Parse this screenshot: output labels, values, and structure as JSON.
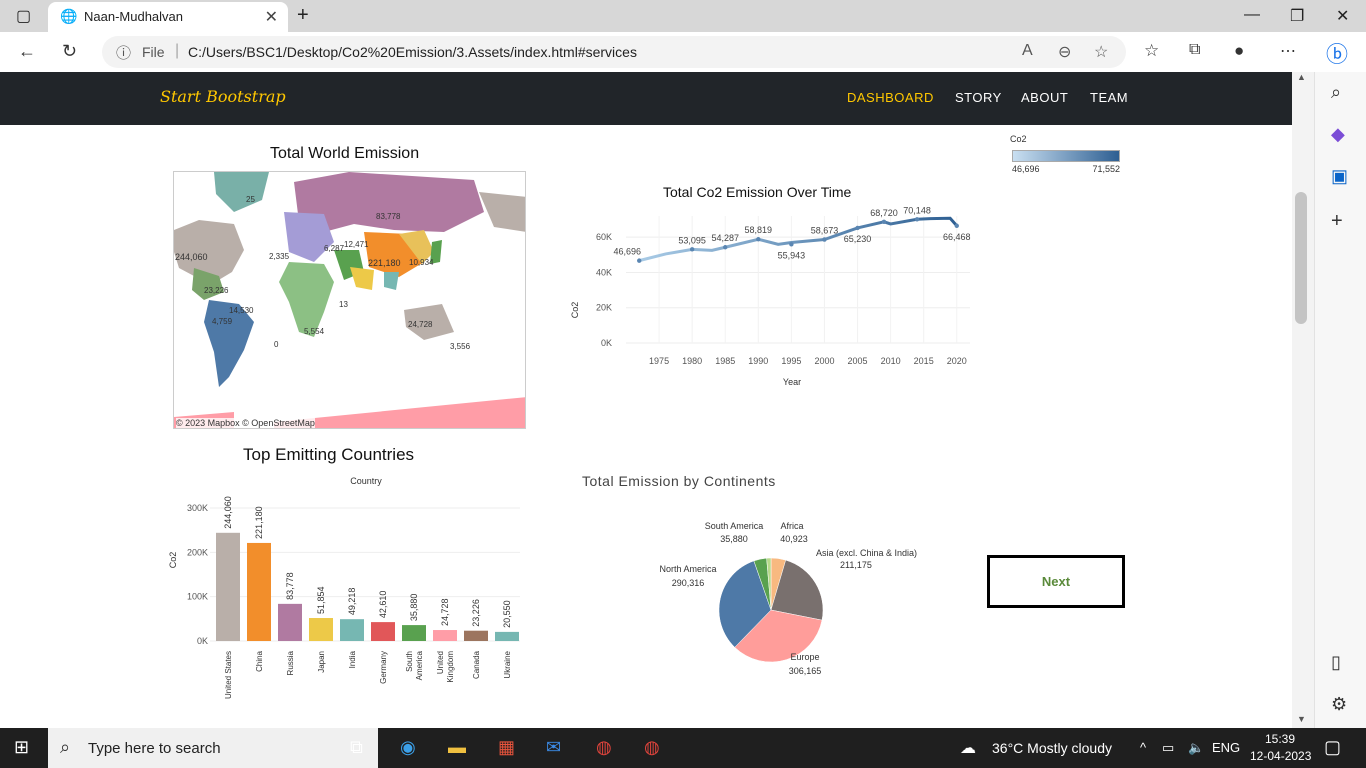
{
  "browser": {
    "tab_title": "Naan-Mudhalvan",
    "addr_label": "File",
    "url": "C:/Users/BSC1/Desktop/Co2%20Emission/3.Assets/index.html#services"
  },
  "site": {
    "brand": "Start Bootstrap",
    "nav": [
      "DASHBOARD",
      "STORY",
      "ABOUT",
      "TEAM"
    ]
  },
  "map": {
    "title": "Total World Emission",
    "credit": "© 2023 Mapbox © OpenStreetMap",
    "labels": [
      "25",
      "83,778",
      "244,060",
      "221,180",
      "24,728",
      "14,530",
      "12,471",
      "10,934",
      "2,335",
      "23,226",
      "4,759",
      "5,554",
      "6,287",
      "3,556",
      "13",
      "0"
    ]
  },
  "legend": {
    "title": "Co2",
    "min": "46,696",
    "max": "71,552"
  },
  "line_title": "Total Co2 Emission Over Time",
  "pie_title": "Total Emission  by Continents",
  "bar_title": "Top Emitting Countries",
  "chart_data": [
    {
      "type": "line",
      "title": "Total Co2 Emission Over Time",
      "xlabel": "Year",
      "ylabel": "Co2",
      "x": [
        1972,
        1976,
        1980,
        1983,
        1985,
        1990,
        1993,
        1995,
        2000,
        2005,
        2009,
        2010,
        2014,
        2016,
        2019,
        2020
      ],
      "y": [
        46696,
        50500,
        53095,
        52500,
        54287,
        58819,
        55943,
        57000,
        58673,
        65230,
        68720,
        67500,
        70148,
        70500,
        70700,
        66468
      ],
      "xticks": [
        "1975",
        "1980",
        "1985",
        "1990",
        "1995",
        "2000",
        "2005",
        "2010",
        "2015",
        "2020"
      ],
      "yticks": [
        "0K",
        "20K",
        "40K",
        "60K"
      ],
      "ylim": [
        0,
        72000
      ],
      "point_labels": [
        {
          "x": 1972,
          "y": 46696,
          "text": "46,696"
        },
        {
          "x": 1980,
          "y": 53095,
          "text": "53,095"
        },
        {
          "x": 1985,
          "y": 54287,
          "text": "54,287"
        },
        {
          "x": 1990,
          "y": 58819,
          "text": "58,819"
        },
        {
          "x": 1995,
          "y": 55943,
          "text": "55,943"
        },
        {
          "x": 2000,
          "y": 58673,
          "text": "58,673"
        },
        {
          "x": 2005,
          "y": 65230,
          "text": "65,230"
        },
        {
          "x": 2009,
          "y": 68720,
          "text": "68,720"
        },
        {
          "x": 2014,
          "y": 70148,
          "text": "70,148"
        },
        {
          "x": 2020,
          "y": 66468,
          "text": "66,468"
        }
      ]
    },
    {
      "type": "bar",
      "title": "Top Emitting Countries",
      "xlabel": "Country",
      "ylabel": "Co2",
      "categories": [
        "United States",
        "China",
        "Russia",
        "Japan",
        "India",
        "Germany",
        "South America",
        "United Kingdom",
        "Canada",
        "Ukraine"
      ],
      "values": [
        244060,
        221180,
        83778,
        51854,
        49218,
        42610,
        35880,
        24728,
        23226,
        20550
      ],
      "labels": [
        "244,060",
        "221,180",
        "83,778",
        "51,854",
        "49,218",
        "42,610",
        "35,880",
        "24,728",
        "23,226",
        "20,550"
      ],
      "colors": [
        "#b9afa9",
        "#f28e2b",
        "#b07aa1",
        "#edc948",
        "#76b7b2",
        "#e15759",
        "#59a14f",
        "#ff9da7",
        "#9c755f",
        "#76b7b2"
      ],
      "yticks": [
        "0K",
        "100K",
        "200K",
        "300K"
      ],
      "ylim": [
        0,
        300000
      ]
    },
    {
      "type": "pie",
      "title": "Total Emission  by Continents",
      "slices": [
        {
          "name": "Africa",
          "value": 40923,
          "label": "40,923",
          "color": "#f8b980"
        },
        {
          "name": "Asia (excl. China & India)",
          "value": 211175,
          "label": "211,175",
          "color": "#79706e"
        },
        {
          "name": "Europe",
          "value": 306165,
          "label": "306,165",
          "color": "#ff9d9a"
        },
        {
          "name": "North America",
          "value": 290316,
          "label": "290,316",
          "color": "#4e79a7"
        },
        {
          "name": "South America",
          "value": 35880,
          "label": "35,880",
          "color": "#59a14f"
        },
        {
          "name": "",
          "value": 12000,
          "label": "",
          "color": "#b6d98a"
        }
      ]
    }
  ],
  "next_label": "Next",
  "taskbar": {
    "search": "Type here to search",
    "weather": "36°C  Mostly cloudy",
    "lang": "ENG",
    "time": "15:39",
    "date": "12-04-2023"
  }
}
